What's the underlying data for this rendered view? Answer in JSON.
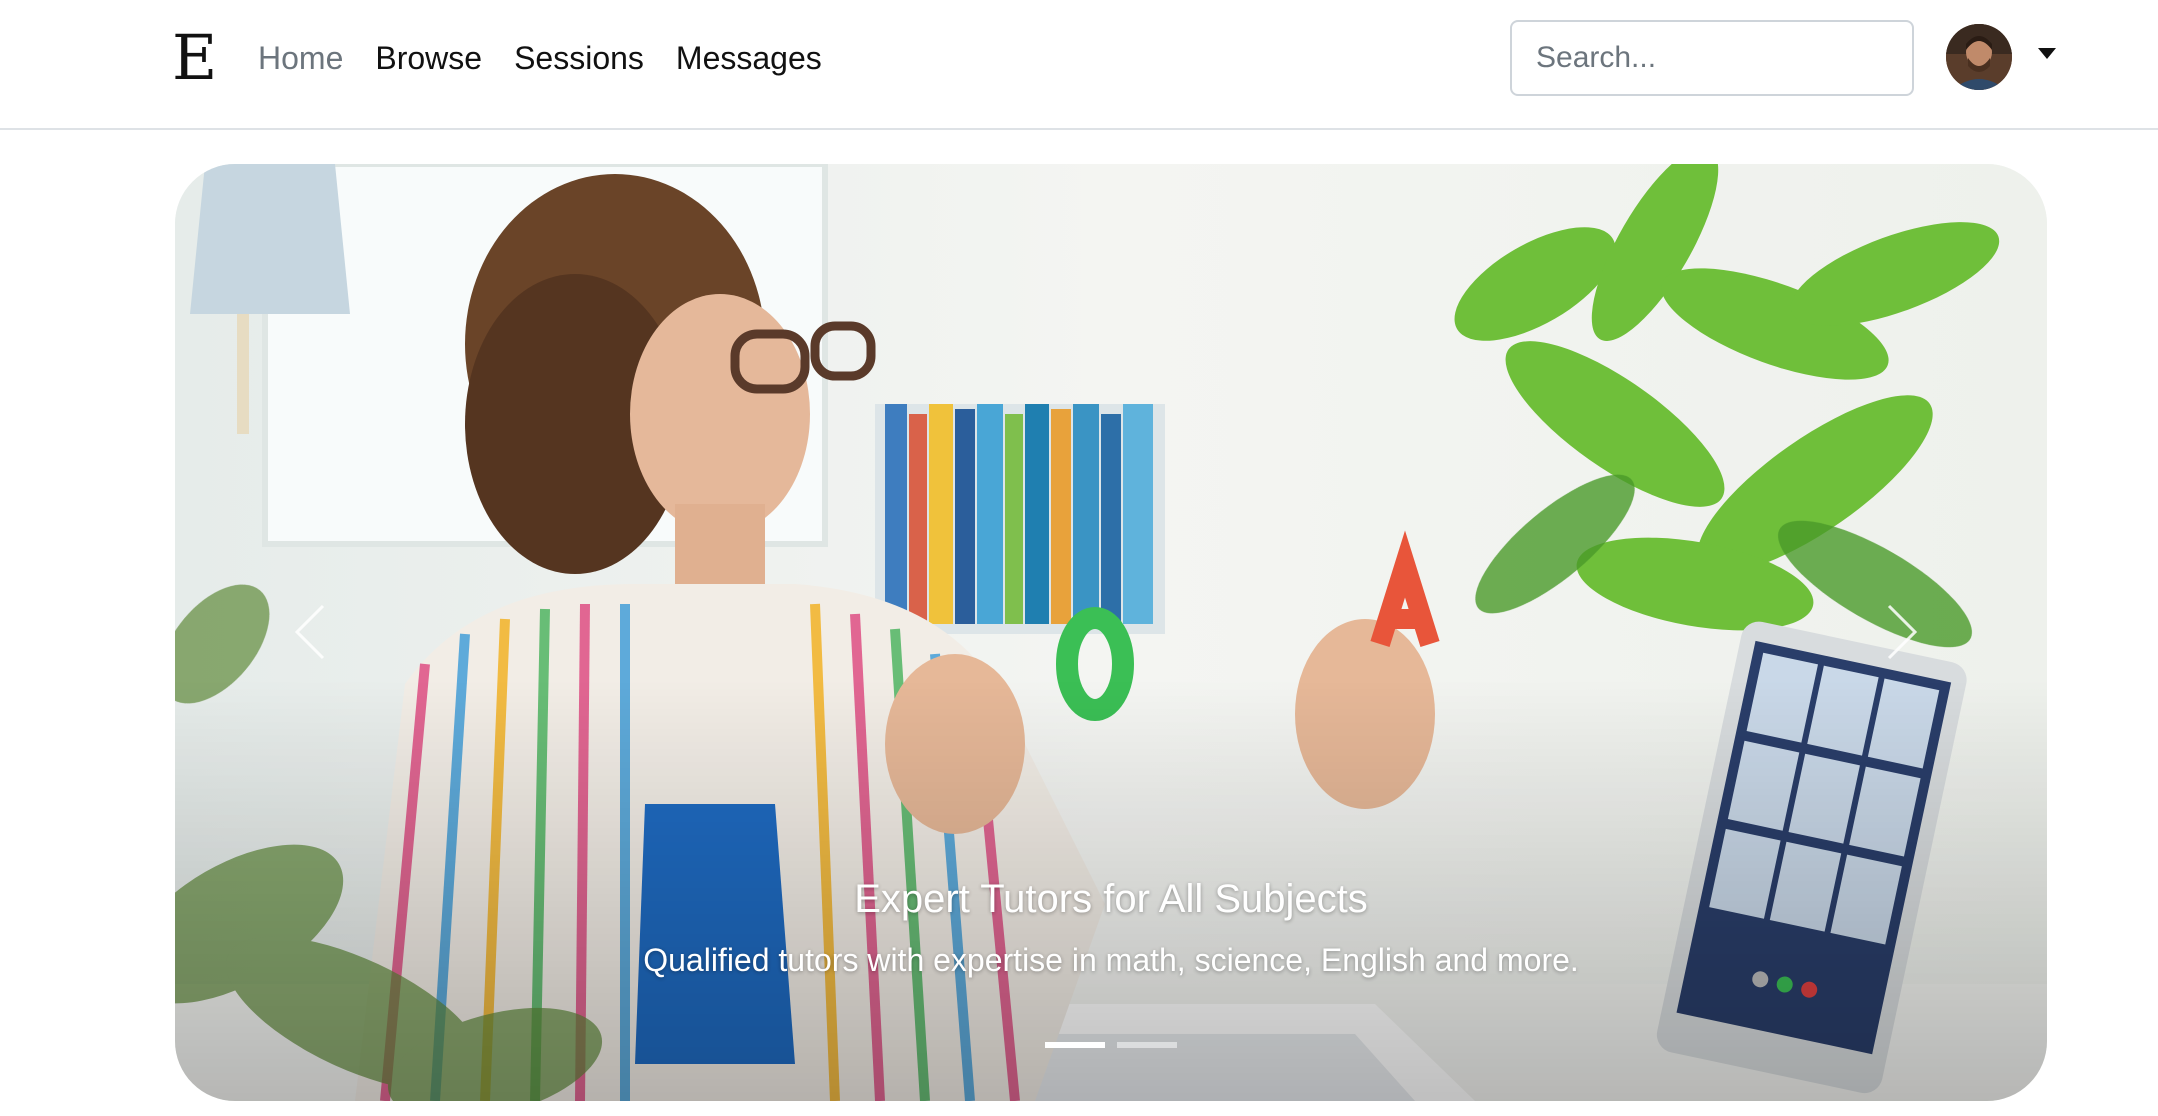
{
  "navbar": {
    "brand": "E",
    "links": [
      {
        "label": "Home",
        "active": true
      },
      {
        "label": "Browse",
        "active": false
      },
      {
        "label": "Sessions",
        "active": false
      },
      {
        "label": "Messages",
        "active": false
      }
    ],
    "search_placeholder": "Search...",
    "user_menu": {
      "avatar_icon": "user-avatar",
      "caret_icon": "caret-down-icon"
    }
  },
  "carousel": {
    "slide_image": "tutor teaching letters over video call",
    "caption_title": "Expert Tutors for All Subjects",
    "caption_text": "Qualified tutors with expertise in math, science, English and more.",
    "prev_icon": "chevron-left-icon",
    "next_icon": "chevron-right-icon",
    "indicator_count": 2,
    "active_index": 0
  },
  "colors": {
    "nav_active": "#6c757d",
    "nav_text": "#111111",
    "border": "#dee2e6"
  }
}
